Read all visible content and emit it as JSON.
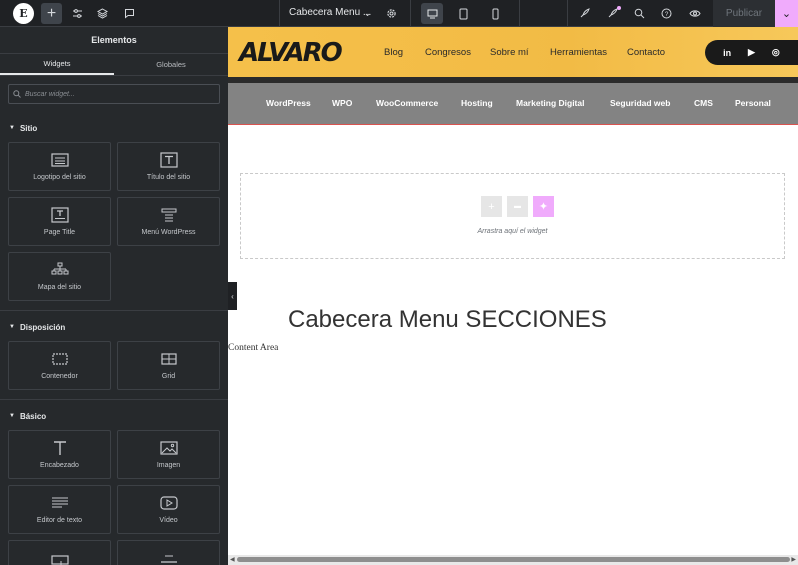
{
  "topbar": {
    "logo_glyph": "E",
    "add_glyph": "+",
    "document_title": "Cabecera Menu ...",
    "publish_label": "Publicar",
    "publish_dropdown_glyph": "⌄",
    "icons": [
      "elementor-logo-icon",
      "plus-icon",
      "sliders-icon",
      "layers-icon",
      "comment-icon",
      "chevron-down-icon",
      "gear-icon",
      "desktop-icon",
      "tablet-icon",
      "mobile-icon",
      "rocket-icon",
      "sparkle-rocket-icon",
      "search-icon",
      "help-icon",
      "eye-icon"
    ]
  },
  "panel": {
    "title": "Elementos",
    "tabs": [
      "Widgets",
      "Globales"
    ],
    "search_placeholder": "Buscar widget...",
    "sections": [
      {
        "title": "Sitio",
        "widgets": [
          "Logotipo del sitio",
          "Título del sitio",
          "Page Title",
          "Menú WordPress",
          "Mapa del sitio"
        ]
      },
      {
        "title": "Disposición",
        "widgets": [
          "Contenedor",
          "Grid"
        ]
      },
      {
        "title": "Básico",
        "widgets": [
          "Encabezado",
          "Imagen",
          "Editor de texto",
          "Vídeo",
          "",
          ""
        ]
      }
    ]
  },
  "site": {
    "brand": "ALVARO",
    "nav": [
      "Blog",
      "Congresos",
      "Sobre mí",
      "Herramientas",
      "Contacto"
    ],
    "social": [
      "in",
      "▶",
      "◎"
    ],
    "menu": [
      "WordPress",
      "WPO",
      "WooCommerce",
      "Hosting",
      "Marketing Digital",
      "Seguridad web",
      "CMS",
      "Personal"
    ]
  },
  "canvas": {
    "drop_label": "Arrastra aquí el widget",
    "drop_buttons": [
      "+",
      "▬",
      "✦"
    ],
    "heading": "Cabecera Menu SECCIONES",
    "content_area": "Content Area"
  },
  "colors": {
    "accent_pink": "#f0abfc",
    "header_yellow": "#f5c04a",
    "menu_gray": "#838383",
    "panel_bg": "#26292c"
  }
}
